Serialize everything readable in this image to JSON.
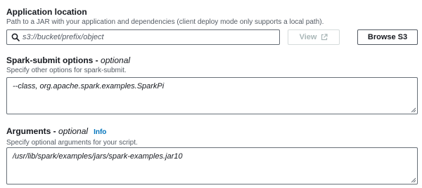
{
  "application_location": {
    "label": "Application location",
    "description": "Path to a JAR with your application and dependencies (client deploy mode only supports a local path).",
    "placeholder": "s3://bucket/prefix/object",
    "view_label": "View",
    "browse_label": "Browse S3"
  },
  "spark_submit": {
    "label": "Spark-submit options",
    "optional": "optional",
    "separator": " - ",
    "description": "Specify other options for spark-submit.",
    "value": "--class, org.apache.spark.examples.SparkPi"
  },
  "arguments": {
    "label": "Arguments",
    "optional": "optional",
    "separator": " - ",
    "info_label": "Info",
    "description": "Specify optional arguments for your script.",
    "value": "/usr/lib/spark/examples/jars/spark-examples.jar10"
  },
  "icons": {
    "search": "search-icon",
    "external": "external-link-icon",
    "resize": "resize-handle-icon"
  },
  "colors": {
    "link": "#0073bb",
    "border": "#687078",
    "muted_text": "#545b64",
    "disabled": "#aab7b8"
  }
}
